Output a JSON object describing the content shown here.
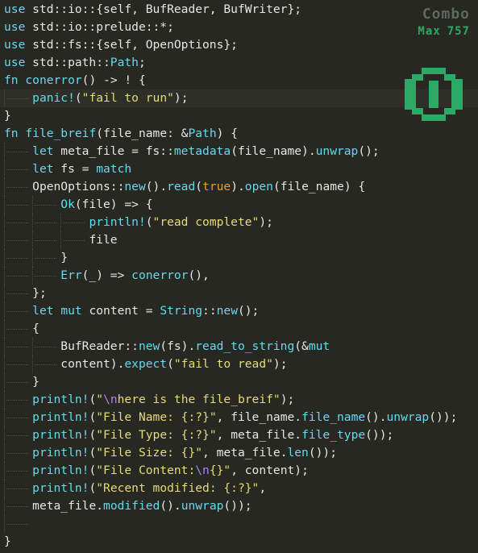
{
  "editor": {
    "current_line": 5,
    "lines": [
      {
        "indent": 0,
        "tokens": [
          [
            "kw",
            "use"
          ],
          [
            "plain",
            " std::io::{self, BufReader, BufWriter};"
          ]
        ]
      },
      {
        "indent": 0,
        "tokens": [
          [
            "kw",
            "use"
          ],
          [
            "plain",
            " std::io::prelude::*;"
          ]
        ]
      },
      {
        "indent": 0,
        "tokens": [
          [
            "kw",
            "use"
          ],
          [
            "plain",
            " std::fs::{self, OpenOptions};"
          ]
        ]
      },
      {
        "indent": 0,
        "tokens": [
          [
            "kw",
            "use"
          ],
          [
            "plain",
            " std::path::"
          ],
          [
            "ty",
            "Path"
          ],
          [
            "plain",
            ";"
          ]
        ]
      },
      {
        "indent": 0,
        "tokens": [
          [
            "kw",
            "fn"
          ],
          [
            "plain",
            " "
          ],
          [
            "fn",
            "conerror"
          ],
          [
            "plain",
            "() -> ! {"
          ]
        ]
      },
      {
        "indent": 1,
        "tokens": [
          [
            "mac",
            "panic!"
          ],
          [
            "plain",
            "("
          ],
          [
            "str",
            "\"fail to run\""
          ],
          [
            "plain",
            ");"
          ]
        ]
      },
      {
        "indent": 0,
        "tokens": [
          [
            "plain",
            "}"
          ]
        ]
      },
      {
        "indent": 0,
        "tokens": [
          [
            "kw",
            "fn"
          ],
          [
            "plain",
            " "
          ],
          [
            "fn",
            "file_breif"
          ],
          [
            "plain",
            "(file_name: &"
          ],
          [
            "ty",
            "Path"
          ],
          [
            "plain",
            ") {"
          ]
        ]
      },
      {
        "indent": 1,
        "tokens": [
          [
            "kw",
            "let"
          ],
          [
            "plain",
            " meta_file = fs::"
          ],
          [
            "fn",
            "metadata"
          ],
          [
            "plain",
            "(file_name)."
          ],
          [
            "fn",
            "unwrap"
          ],
          [
            "plain",
            "();"
          ]
        ]
      },
      {
        "indent": 1,
        "tokens": [
          [
            "kw",
            "let"
          ],
          [
            "plain",
            " fs = "
          ],
          [
            "kw",
            "match"
          ]
        ]
      },
      {
        "indent": 1,
        "tokens": [
          [
            "plain",
            "OpenOptions::"
          ],
          [
            "fn",
            "new"
          ],
          [
            "plain",
            "()."
          ],
          [
            "fn",
            "read"
          ],
          [
            "plain",
            "("
          ],
          [
            "lit",
            "true"
          ],
          [
            "plain",
            ")."
          ],
          [
            "fn",
            "open"
          ],
          [
            "plain",
            "(file_name) {"
          ]
        ]
      },
      {
        "indent": 2,
        "tokens": [
          [
            "ty",
            "Ok"
          ],
          [
            "plain",
            "(file) => {"
          ]
        ]
      },
      {
        "indent": 3,
        "tokens": [
          [
            "mac",
            "println!"
          ],
          [
            "plain",
            "("
          ],
          [
            "str",
            "\"read complete\""
          ],
          [
            "plain",
            ");"
          ]
        ]
      },
      {
        "indent": 3,
        "tokens": [
          [
            "plain",
            "file"
          ]
        ]
      },
      {
        "indent": 2,
        "tokens": [
          [
            "plain",
            "}"
          ]
        ]
      },
      {
        "indent": 2,
        "tokens": [
          [
            "ty",
            "Err"
          ],
          [
            "plain",
            "(_) => "
          ],
          [
            "fn",
            "conerror"
          ],
          [
            "plain",
            "(),"
          ]
        ]
      },
      {
        "indent": 1,
        "tokens": [
          [
            "plain",
            "};"
          ]
        ]
      },
      {
        "indent": 1,
        "tokens": [
          [
            "kw",
            "let"
          ],
          [
            "plain",
            " "
          ],
          [
            "kw",
            "mut"
          ],
          [
            "plain",
            " content = "
          ],
          [
            "ty",
            "String"
          ],
          [
            "plain",
            "::"
          ],
          [
            "fn",
            "new"
          ],
          [
            "plain",
            "();"
          ]
        ]
      },
      {
        "indent": 1,
        "tokens": [
          [
            "plain",
            "{"
          ]
        ]
      },
      {
        "indent": 2,
        "tokens": [
          [
            "plain",
            "BufReader::"
          ],
          [
            "fn",
            "new"
          ],
          [
            "plain",
            "(fs)."
          ],
          [
            "fn",
            "read_to_string"
          ],
          [
            "plain",
            "(&"
          ],
          [
            "kw",
            "mut"
          ]
        ]
      },
      {
        "indent": 2,
        "tokens": [
          [
            "plain",
            "content)."
          ],
          [
            "fn",
            "expect"
          ],
          [
            "plain",
            "("
          ],
          [
            "str",
            "\"fail to read\""
          ],
          [
            "plain",
            ");"
          ]
        ]
      },
      {
        "indent": 1,
        "tokens": [
          [
            "plain",
            "}"
          ]
        ]
      },
      {
        "indent": 1,
        "tokens": [
          [
            "mac",
            "println!"
          ],
          [
            "plain",
            "("
          ],
          [
            "str",
            "\""
          ],
          [
            "esc",
            "\\n"
          ],
          [
            "str",
            "here is the file_breif\""
          ],
          [
            "plain",
            ");"
          ]
        ]
      },
      {
        "indent": 1,
        "tokens": [
          [
            "mac",
            "println!"
          ],
          [
            "plain",
            "("
          ],
          [
            "str",
            "\"File Name: {:?}\""
          ],
          [
            "plain",
            ", file_name."
          ],
          [
            "fn",
            "file_name"
          ],
          [
            "plain",
            "()."
          ],
          [
            "fn",
            "unwrap"
          ],
          [
            "plain",
            "());"
          ]
        ]
      },
      {
        "indent": 1,
        "tokens": [
          [
            "mac",
            "println!"
          ],
          [
            "plain",
            "("
          ],
          [
            "str",
            "\"File Type: {:?}\""
          ],
          [
            "plain",
            ", meta_file."
          ],
          [
            "fn",
            "file_type"
          ],
          [
            "plain",
            "());"
          ]
        ]
      },
      {
        "indent": 1,
        "tokens": [
          [
            "mac",
            "println!"
          ],
          [
            "plain",
            "("
          ],
          [
            "str",
            "\"File Size: {}\""
          ],
          [
            "plain",
            ", meta_file."
          ],
          [
            "fn",
            "len"
          ],
          [
            "plain",
            "());"
          ]
        ]
      },
      {
        "indent": 1,
        "tokens": [
          [
            "mac",
            "println!"
          ],
          [
            "plain",
            "("
          ],
          [
            "str",
            "\"File Content:"
          ],
          [
            "esc",
            "\\n"
          ],
          [
            "str",
            "{}\""
          ],
          [
            "plain",
            ", content);"
          ]
        ]
      },
      {
        "indent": 1,
        "tokens": [
          [
            "mac",
            "println!"
          ],
          [
            "plain",
            "("
          ],
          [
            "str",
            "\"Recent modified: {:?}\""
          ],
          [
            "plain",
            ","
          ]
        ]
      },
      {
        "indent": 1,
        "tokens": [
          [
            "plain",
            "meta_file."
          ],
          [
            "fn",
            "modified"
          ],
          [
            "plain",
            "()."
          ],
          [
            "fn",
            "unwrap"
          ],
          [
            "plain",
            "());"
          ]
        ]
      },
      {
        "indent": 1,
        "tokens": []
      },
      {
        "indent": 0,
        "tokens": [
          [
            "plain",
            "}"
          ]
        ]
      }
    ]
  },
  "combo": {
    "title": "Combo",
    "max_label": "Max",
    "max_value": "757",
    "current_count": "0",
    "color": "#2ea866",
    "title_color": "#5d6b62"
  },
  "colors": {
    "background": "#272822",
    "current_line": "#2e2f29",
    "keyword": "#66d9ef",
    "string": "#e6db74",
    "literal": "#fd971f",
    "escape": "#ae81ff",
    "text": "#e6e6e6"
  }
}
